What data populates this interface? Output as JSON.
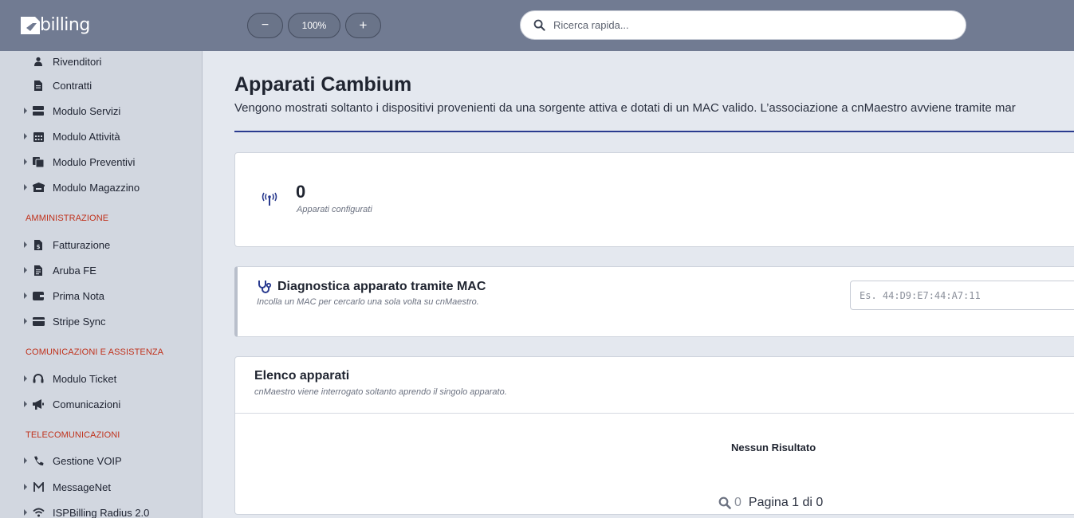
{
  "app": {
    "logo_text": "billing"
  },
  "toolbar": {
    "zoom_out_label": "−",
    "zoom_level": "100%",
    "zoom_in_label": "+"
  },
  "search": {
    "placeholder": "Ricerca rapida..."
  },
  "sidebar": {
    "items": [
      {
        "label": "Rivenditori",
        "icon": "reseller-icon"
      },
      {
        "label": "Contratti",
        "icon": "document-icon"
      },
      {
        "label": "Modulo Servizi",
        "icon": "server-icon"
      },
      {
        "label": "Modulo Attività",
        "icon": "calendar-icon"
      },
      {
        "label": "Modulo Preventivi",
        "icon": "quotes-icon"
      },
      {
        "label": "Modulo Magazzino",
        "icon": "warehouse-icon"
      },
      {
        "label": "Fatturazione",
        "icon": "invoice-icon"
      },
      {
        "label": "Aruba FE",
        "icon": "invoice-file-icon"
      },
      {
        "label": "Prima Nota",
        "icon": "wallet-icon"
      },
      {
        "label": "Stripe Sync",
        "icon": "credit-card-icon"
      },
      {
        "label": "Modulo Ticket",
        "icon": "headset-icon"
      },
      {
        "label": "Comunicazioni",
        "icon": "megaphone-icon"
      },
      {
        "label": "Gestione VOIP",
        "icon": "phone-icon"
      },
      {
        "label": "MessageNet",
        "icon": "messagenet-icon"
      },
      {
        "label": "ISPBilling Radius 2.0",
        "icon": "wifi-icon"
      }
    ],
    "sections": {
      "admin": "AMMINISTRAZIONE",
      "comms": "COMUNICAZIONI E ASSISTENZA",
      "telecom": "TELECOMUNICAZIONI"
    }
  },
  "page": {
    "title": "Apparati Cambium",
    "subtitle": "Vengono mostrati soltanto i dispositivi provenienti da una sorgente attiva e dotati di un MAC valido. L’associazione a cnMaestro avviene tramite mar"
  },
  "stats": {
    "count": "0",
    "label": "Apparati configurati",
    "icon": "antenna-icon"
  },
  "diagnostics": {
    "title": "Diagnostica apparato tramite MAC",
    "subtitle": "Incolla un MAC per cercarlo una sola volta su cnMaestro.",
    "mac_placeholder": "Es. 44:D9:E7:44:A7:11",
    "icon": "stethoscope-icon"
  },
  "device_list": {
    "title": "Elenco apparati",
    "subtitle": "cnMaestro viene interrogato soltanto aprendo il singolo apparato.",
    "empty_message": "Nessun Risultato",
    "result_count": "0",
    "pagination": "Pagina 1 di 0"
  },
  "colors": {
    "topbar": "#717b92",
    "sidebar": "#d2d7e0",
    "section_heading": "#c0321c",
    "accent": "#2a3b8f"
  }
}
